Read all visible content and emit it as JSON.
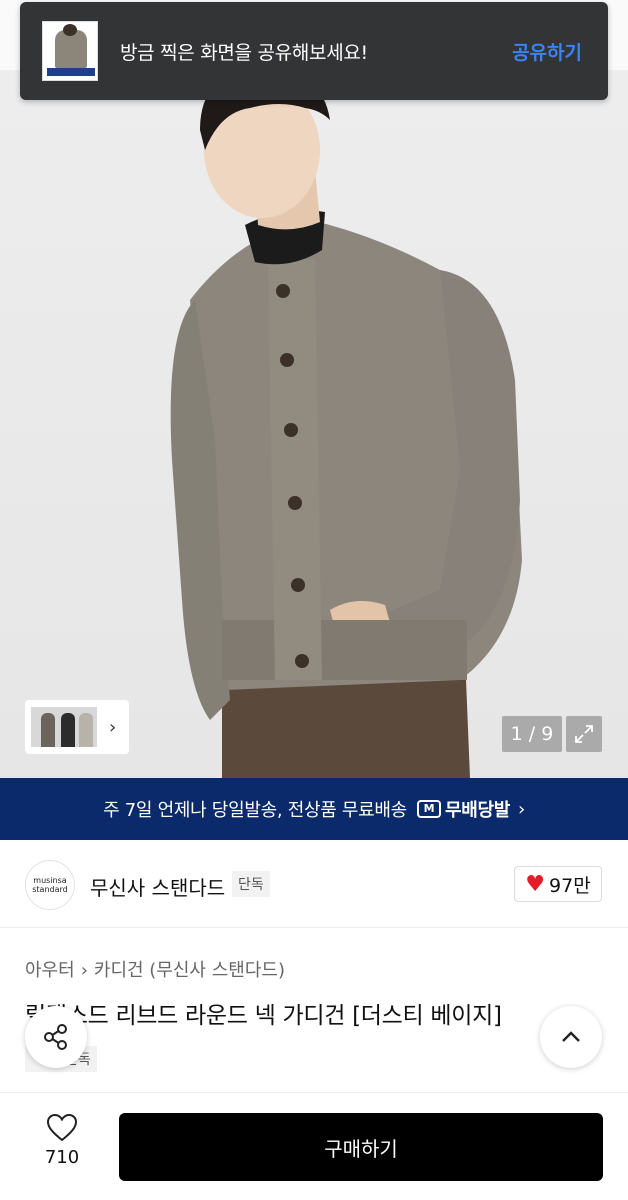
{
  "toast": {
    "message": "방금 찍은 화면을 공유해보세요!",
    "action": "공유하기"
  },
  "gallery": {
    "counter": "1 / 9"
  },
  "shipping_banner": {
    "text": "주 7일 언제나 당일발송, 전상품 무료배송",
    "badge": "무배당발",
    "badge_icon_letter": "M"
  },
  "brand": {
    "logo_line1": "musinsa",
    "logo_line2": "standard",
    "name": "무신사 스탠다드",
    "tag": "단독",
    "likes": "97만"
  },
  "product": {
    "breadcrumb": [
      "아우터",
      "카디건 (무신사 스탠다드)"
    ],
    "title": "릴랙스드 리브드 라운드 넥 가디건 [더스티 베이지]",
    "exclusive_tag": "단독"
  },
  "bottom": {
    "wish_count": "710",
    "buy_label": "구매하기"
  },
  "colors": {
    "banner_bg": "#0b2a6b",
    "toast_bg": "#333436",
    "toast_action": "#3b82f6",
    "heart": "#e41c2a"
  }
}
